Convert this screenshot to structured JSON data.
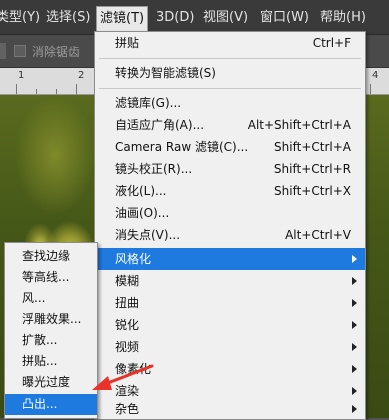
{
  "menubar": {
    "items": [
      {
        "label": "类型(Y)"
      },
      {
        "label": "选择(S)"
      },
      {
        "label": "滤镜(T)"
      },
      {
        "label": "3D(D)"
      },
      {
        "label": "视图(V)"
      },
      {
        "label": "窗口(W)"
      },
      {
        "label": "帮助(H)"
      }
    ]
  },
  "options_bar": {
    "antialias_label": "消除锯齿"
  },
  "ruler": {
    "numbers": [
      "1",
      "2",
      "3",
      "4"
    ]
  },
  "filter_menu": {
    "items": [
      {
        "label": "拼贴",
        "shortcut": "Ctrl+F"
      },
      {
        "label": "转换为智能滤镜(S)",
        "shortcut": ""
      },
      {
        "label": "滤镜库(G)...",
        "shortcut": ""
      },
      {
        "label": "自适应广角(A)...",
        "shortcut": "Alt+Shift+Ctrl+A"
      },
      {
        "label": "Camera Raw 滤镜(C)...",
        "shortcut": "Shift+Ctrl+A"
      },
      {
        "label": "镜头校正(R)...",
        "shortcut": "Shift+Ctrl+R"
      },
      {
        "label": "液化(L)...",
        "shortcut": "Shift+Ctrl+X"
      },
      {
        "label": "油画(O)...",
        "shortcut": ""
      },
      {
        "label": "消失点(V)...",
        "shortcut": "Alt+Ctrl+V"
      },
      {
        "label": "风格化",
        "shortcut": ""
      },
      {
        "label": "模糊",
        "shortcut": ""
      },
      {
        "label": "扭曲",
        "shortcut": ""
      },
      {
        "label": "锐化",
        "shortcut": ""
      },
      {
        "label": "视频",
        "shortcut": ""
      },
      {
        "label": "像素化",
        "shortcut": ""
      },
      {
        "label": "渲染",
        "shortcut": ""
      },
      {
        "label": "杂色",
        "shortcut": ""
      }
    ]
  },
  "stylize_submenu": {
    "items": [
      {
        "label": "查找边缘"
      },
      {
        "label": "等高线..."
      },
      {
        "label": "风..."
      },
      {
        "label": "浮雕效果..."
      },
      {
        "label": "扩散..."
      },
      {
        "label": "拼贴..."
      },
      {
        "label": "曝光过度"
      },
      {
        "label": "凸出..."
      }
    ]
  },
  "colors": {
    "highlight": "#1f7ae0",
    "annotation_arrow": "#e8322a"
  }
}
